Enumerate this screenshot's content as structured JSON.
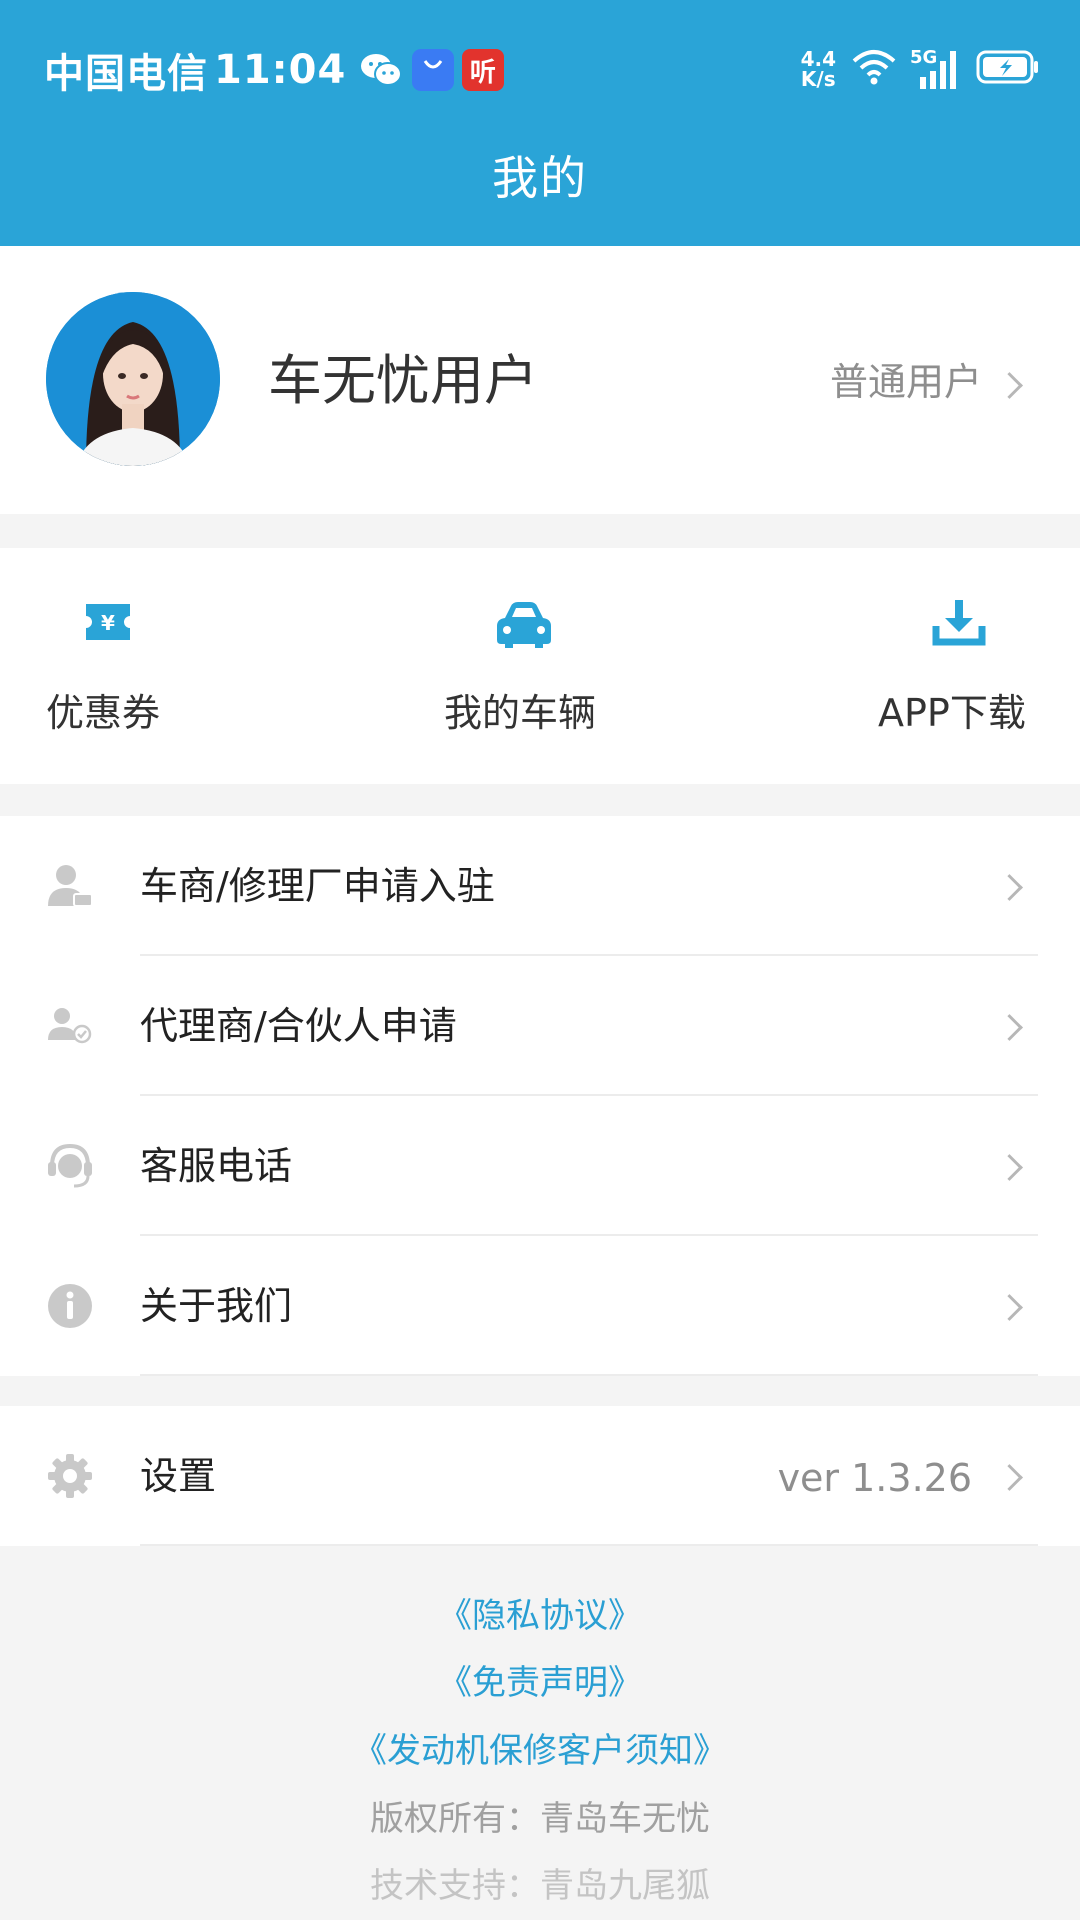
{
  "status_bar": {
    "carrier": "中国电信",
    "time": "11:04",
    "net_speed_value": "4.4",
    "net_speed_unit": "K/s",
    "network_type": "5G",
    "app_icon_red_text": "听"
  },
  "header": {
    "title": "我的"
  },
  "profile": {
    "name": "车无忧用户",
    "level": "普通用户"
  },
  "quick_actions": [
    {
      "label": "优惠券",
      "icon": "coupon-icon"
    },
    {
      "label": "我的车辆",
      "icon": "car-icon"
    },
    {
      "label": "APP下载",
      "icon": "download-icon"
    }
  ],
  "menu": [
    {
      "label": "车商/修理厂申请入驻",
      "icon": "merchant-user-icon"
    },
    {
      "label": "代理商/合伙人申请",
      "icon": "agent-user-icon"
    },
    {
      "label": "客服电话",
      "icon": "customer-service-icon"
    },
    {
      "label": "关于我们",
      "icon": "info-icon"
    }
  ],
  "settings": {
    "label": "设置",
    "version": "ver 1.3.26",
    "icon": "gear-icon"
  },
  "footer": {
    "privacy": "《隐私协议》",
    "disclaimer": "《免责声明》",
    "engine_notice": "《发动机保修客户须知》",
    "copyright": "版权所有：青岛车无忧",
    "tech_support": "技术支持：青岛九尾狐"
  },
  "colors": {
    "primary": "#2aa4d7",
    "link": "#2a9fd3",
    "muted_text": "#8e8e8e",
    "background": "#f4f4f4"
  }
}
